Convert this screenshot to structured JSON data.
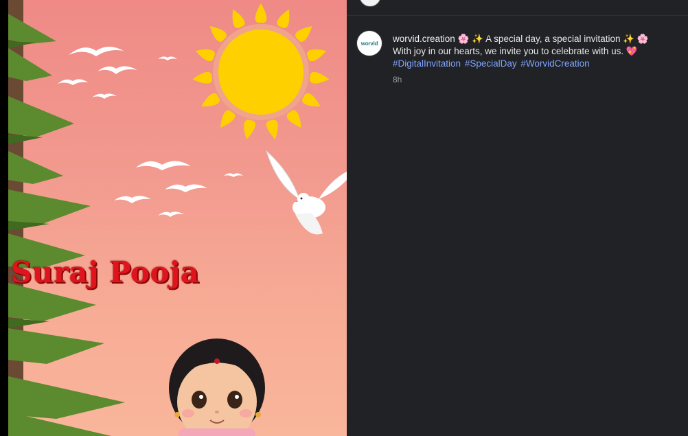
{
  "post": {
    "overlay_title": "Suraj Pooja"
  },
  "comment": {
    "username": "worvid.creation",
    "avatar_logo_text": "worvid",
    "line1": "🌸 ✨ A special day, a special invitation ✨ 🌸",
    "line2": "With joy in our hearts, we invite you to celebrate with us. 💖",
    "hashtags": [
      "#DigitalInvitation",
      "#SpecialDay",
      "#WorvidCreation"
    ],
    "timestamp": "8h"
  },
  "colors": {
    "panel_bg": "#212226",
    "hashtag": "#7fa4ff",
    "title_red": "#e0141c",
    "sun": "#ffd000"
  }
}
